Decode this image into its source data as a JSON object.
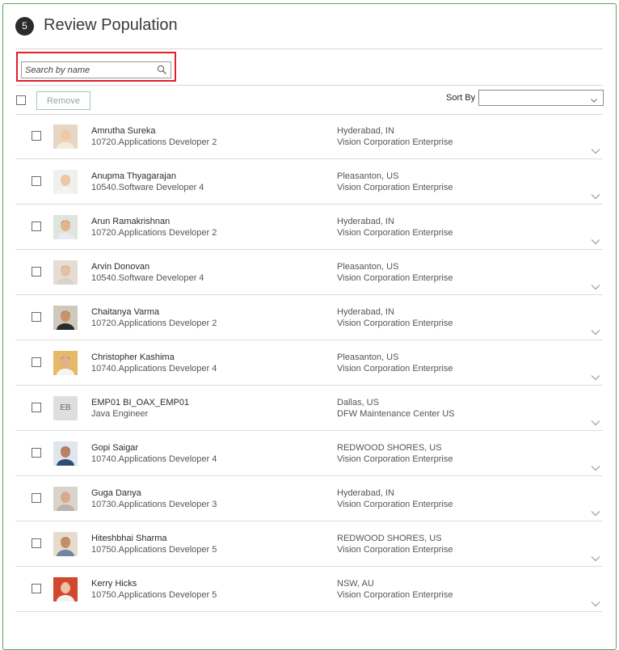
{
  "section": {
    "step": "5",
    "title": "Review Population"
  },
  "search": {
    "placeholder": "Search by name",
    "value": ""
  },
  "toolbar": {
    "remove_label": "Remove",
    "sort_label": "Sort By",
    "sort_value": ""
  },
  "icons": {
    "search": "search-icon",
    "dropdown": "chevron-down-icon",
    "expand": "chevron-down-icon"
  },
  "colors": {
    "border_accent": "#59a266",
    "highlight": "#e0202a"
  },
  "people": [
    {
      "name": "Amrutha Sureka",
      "job": "10720.Applications Developer 2",
      "location": "Hyderabad, IN",
      "org": "Vision Corporation Enterprise",
      "initials": ""
    },
    {
      "name": "Anupma Thyagarajan",
      "job": "10540.Software Developer 4",
      "location": "Pleasanton, US",
      "org": "Vision Corporation Enterprise",
      "initials": ""
    },
    {
      "name": "Arun Ramakrishnan",
      "job": "10720.Applications Developer 2",
      "location": "Hyderabad, IN",
      "org": "Vision Corporation Enterprise",
      "initials": ""
    },
    {
      "name": "Arvin Donovan",
      "job": "10540.Software Developer 4",
      "location": "Pleasanton, US",
      "org": "Vision Corporation Enterprise",
      "initials": ""
    },
    {
      "name": "Chaitanya Varma",
      "job": "10720.Applications Developer 2",
      "location": "Hyderabad, IN",
      "org": "Vision Corporation Enterprise",
      "initials": ""
    },
    {
      "name": "Christopher Kashima",
      "job": "10740.Applications Developer 4",
      "location": "Pleasanton, US",
      "org": "Vision Corporation Enterprise",
      "initials": ""
    },
    {
      "name": "EMP01 BI_OAX_EMP01",
      "job": "Java Engineer",
      "location": "Dallas, US",
      "org": "DFW Maintenance Center US",
      "initials": "EB"
    },
    {
      "name": "Gopi Saigar",
      "job": "10740.Applications Developer 4",
      "location": "REDWOOD SHORES, US",
      "org": "Vision Corporation Enterprise",
      "initials": ""
    },
    {
      "name": "Guga Danya",
      "job": "10730.Applications Developer 3",
      "location": "Hyderabad, IN",
      "org": "Vision Corporation Enterprise",
      "initials": ""
    },
    {
      "name": "Hiteshbhai Sharma",
      "job": "10750.Applications Developer 5",
      "location": "REDWOOD SHORES, US",
      "org": "Vision Corporation Enterprise",
      "initials": ""
    },
    {
      "name": "Kerry Hicks",
      "job": "10750.Applications Developer 5",
      "location": "NSW, AU",
      "org": "Vision Corporation Enterprise",
      "initials": ""
    }
  ]
}
